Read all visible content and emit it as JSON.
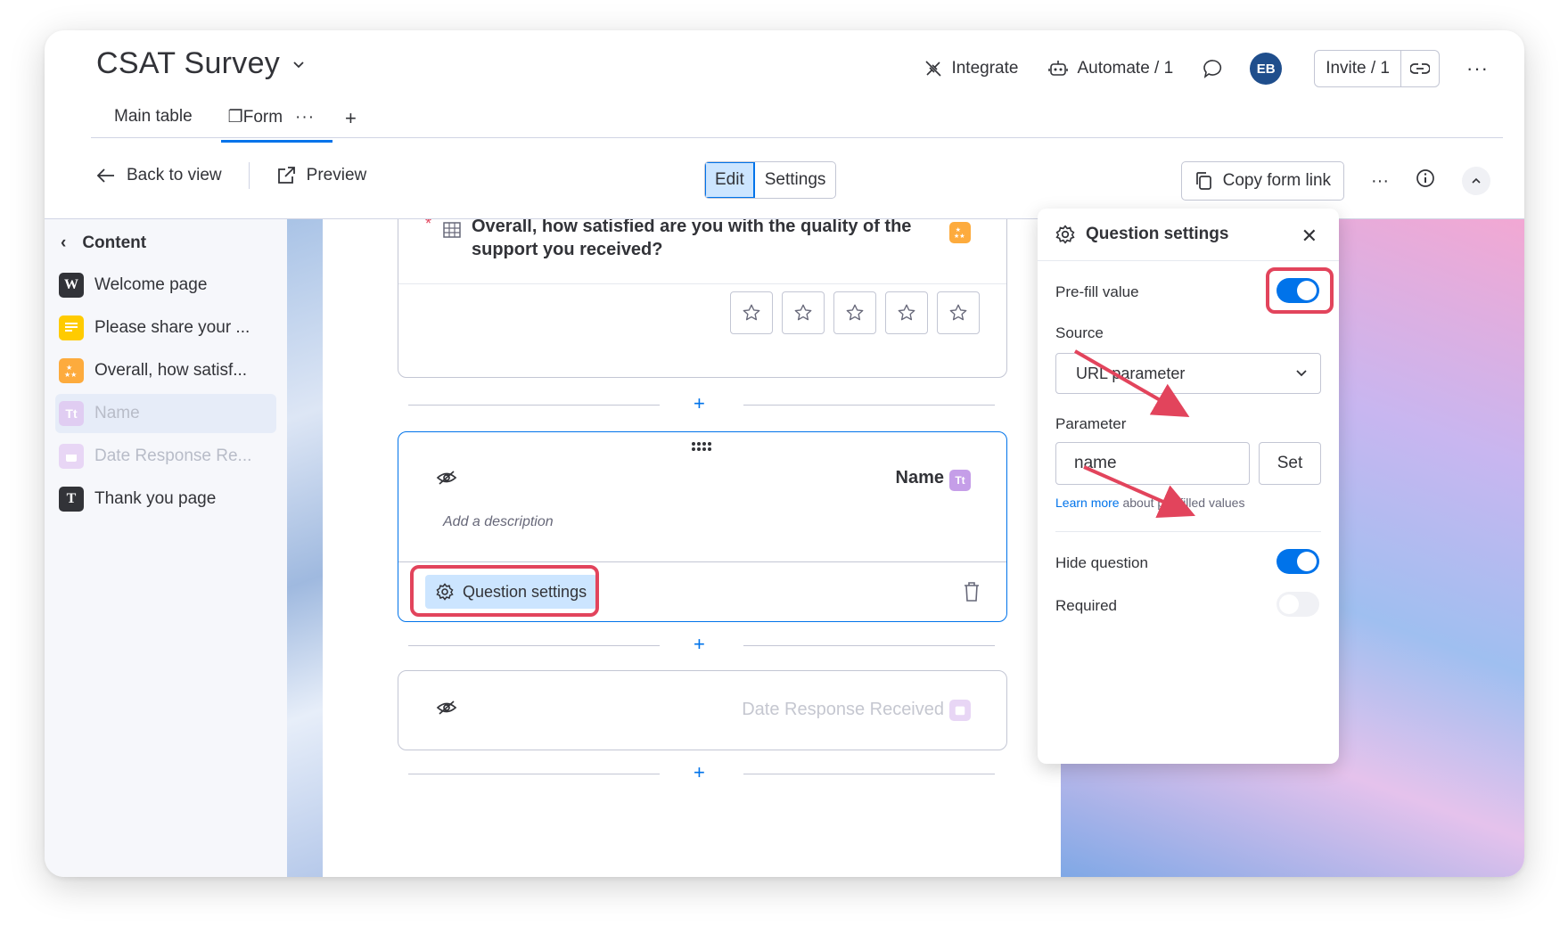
{
  "header": {
    "board_title": "CSAT Survey",
    "tabs": [
      {
        "label": "Main table"
      },
      {
        "label": "Form",
        "glyph": "❐"
      }
    ],
    "actions": {
      "integrate": "Integrate",
      "automate": "Automate / 1",
      "avatar_initials": "EB",
      "invite": "Invite / 1"
    }
  },
  "toolbar": {
    "back": "Back to view",
    "preview": "Preview",
    "mode_edit": "Edit",
    "mode_settings": "Settings",
    "copy_link": "Copy form link"
  },
  "sidebar": {
    "heading": "Content",
    "items": [
      {
        "label": "Welcome page",
        "icon_glyph": "W"
      },
      {
        "label": "Please share your ...",
        "icon_glyph": ""
      },
      {
        "label": "Overall, how satisf...",
        "icon_glyph": ""
      },
      {
        "label": "Name",
        "icon_glyph": "Tt"
      },
      {
        "label": "Date Response Re...",
        "icon_glyph": ""
      },
      {
        "label": "Thank you page",
        "icon_glyph": "T"
      }
    ]
  },
  "form": {
    "rating_question": {
      "required_mark": "*",
      "title": "Overall, how satisfied are you with the quality of the support you received?",
      "star_count": 5
    },
    "name_question": {
      "title": "Name",
      "type_glyph": "Tt",
      "description_placeholder": "Add a description",
      "settings_button": "Question settings"
    },
    "date_question": {
      "title": "Date Response Received"
    }
  },
  "panel": {
    "title": "Question settings",
    "prefill_label": "Pre-fill value",
    "prefill_on": true,
    "source_label": "Source",
    "source_value": "URL parameter",
    "parameter_label": "Parameter",
    "parameter_value": "name",
    "set_button": "Set",
    "learn_more_link": "Learn more",
    "learn_more_text": " about pre-filled values",
    "hide_question_label": "Hide question",
    "hide_question_on": true,
    "required_label": "Required",
    "required_on": false
  },
  "colors": {
    "accent": "#0073ea",
    "highlight": "#e2445c",
    "avatar": "#1f4e8c",
    "rating_icon": "#fdab3d",
    "text_icon": "#a25ddc",
    "long_text_icon": "#ffcb00"
  }
}
